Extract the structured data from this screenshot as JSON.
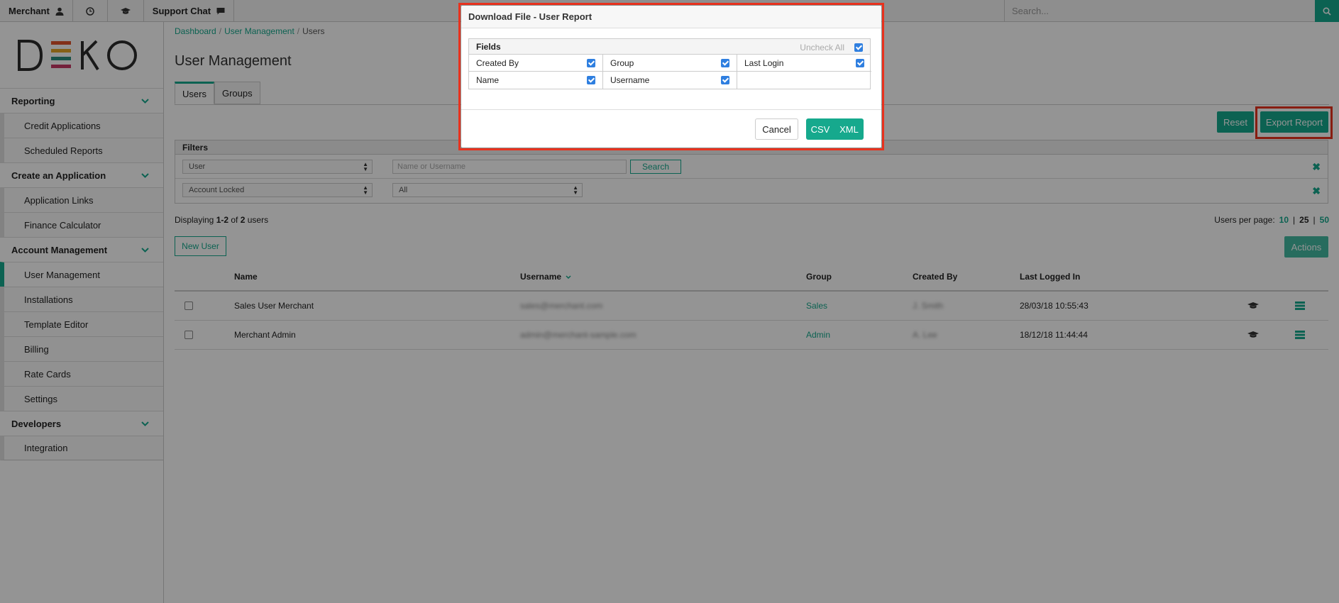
{
  "topbar": {
    "merchant_label": "Merchant",
    "support_label": "Support Chat",
    "search_placeholder": "Search..."
  },
  "sidebar": {
    "logo": "DEKO",
    "sections": [
      {
        "label": "Reporting",
        "items": [
          "Credit Applications",
          "Scheduled Reports"
        ]
      },
      {
        "label": "Create an Application",
        "items": [
          "Application Links",
          "Finance Calculator"
        ]
      },
      {
        "label": "Account Management",
        "items": [
          "User Management",
          "Installations",
          "Template Editor",
          "Billing",
          "Rate Cards",
          "Settings"
        ]
      },
      {
        "label": "Developers",
        "items": [
          "Integration"
        ]
      }
    ]
  },
  "breadcrumb": {
    "dashboard": "Dashboard",
    "user_management": "User Management",
    "current": "Users"
  },
  "page": {
    "title": "User Management",
    "tab_users": "Users",
    "tab_groups": "Groups",
    "reset_label": "Reset",
    "export_label": "Export Report"
  },
  "filters": {
    "heading": "Filters",
    "row1_select": "User",
    "row1_placeholder": "Name or Username",
    "search_label": "Search",
    "row2_select": "Account Locked",
    "row2_value": "All"
  },
  "listing": {
    "disp_pre": "Displaying ",
    "disp_range": "1-2",
    "disp_mid": " of ",
    "disp_total": "2",
    "disp_post": " users",
    "perpage_label": "Users per page:",
    "perpage_10": "10",
    "perpage_25": "25",
    "perpage_50": "50",
    "new_user_label": "New User",
    "actions_label": "Actions"
  },
  "table": {
    "headers": {
      "name": "Name",
      "username": "Username",
      "group": "Group",
      "created_by": "Created By",
      "last_logged_in": "Last Logged In"
    },
    "rows": [
      {
        "name": "Sales User Merchant",
        "username": "sales@merchant.com",
        "group": "Sales",
        "created_by": "J. Smith",
        "last": "28/03/18 10:55:43"
      },
      {
        "name": "Merchant Admin",
        "username": "admin@merchant-sample.com",
        "group": "Admin",
        "created_by": "A. Lee",
        "last": "18/12/18 11:44:44"
      }
    ]
  },
  "modal": {
    "title": "Download File - User Report",
    "fields_heading": "Fields",
    "uncheck_all": "Uncheck All",
    "fields": [
      "Created By",
      "Group",
      "Last Login",
      "Name",
      "Username",
      ""
    ],
    "cancel_label": "Cancel",
    "csv_label": "CSV",
    "xml_label": "XML"
  },
  "colors": {
    "accent": "#16a98d",
    "highlight": "#e8321e",
    "checkbox": "#2f7fe0"
  }
}
